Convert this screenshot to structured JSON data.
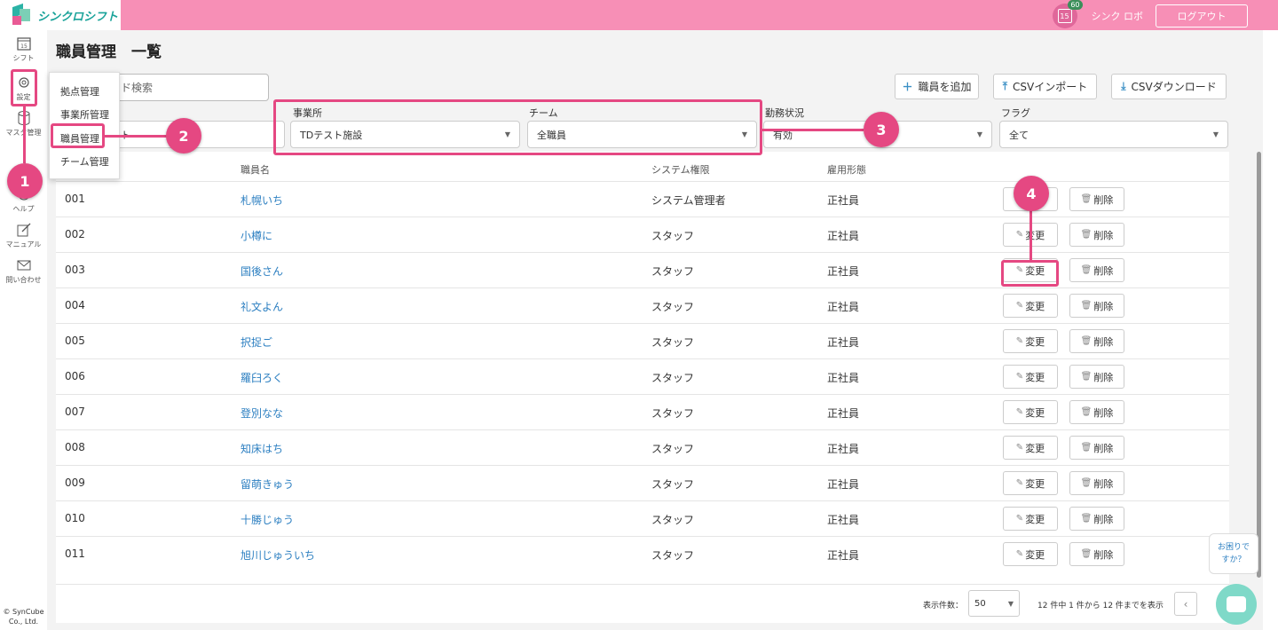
{
  "app": {
    "logo_text": "シンクロシフト",
    "user_name": "シンク ロボ",
    "notification_count": "60",
    "calendar_day": "15",
    "logout_label": "ログアウト"
  },
  "sidebar": {
    "items": [
      {
        "label": "シフト",
        "icon": "calendar-icon"
      },
      {
        "label": "設定",
        "icon": "gear-icon"
      },
      {
        "label": "マスタ管理",
        "icon": "database-icon"
      },
      {
        "label": "ヘルプ",
        "icon": "help-icon"
      },
      {
        "label": "マニュアル",
        "icon": "edit-icon"
      },
      {
        "label": "問い合わせ",
        "icon": "mail-icon"
      }
    ],
    "copyright_line1": "© SynCube",
    "copyright_line2": "Co., Ltd."
  },
  "settings_menu": {
    "items": [
      "拠点管理",
      "事業所管理",
      "職員管理",
      "チーム管理"
    ]
  },
  "page": {
    "title": "職員管理　一覧",
    "search_text": "ド検索",
    "buttons": {
      "add": "職員を追加",
      "csv_import": "CSVインポート",
      "csv_download": "CSVダウンロード"
    }
  },
  "filters": {
    "office": {
      "label": "事業所",
      "value": "TDテスト施設"
    },
    "team": {
      "label": "チーム",
      "value": "全職員"
    },
    "status": {
      "label": "勤務状況",
      "value": "有効"
    },
    "flag": {
      "label": "フラグ",
      "value": "全て"
    },
    "left_partial_value": "ト"
  },
  "table": {
    "headers": [
      "職員名",
      "システム権限",
      "雇用形態"
    ],
    "edit_label": "変更",
    "delete_label": "削除",
    "rows": [
      {
        "id": "001",
        "name": "札幌いち",
        "role": "システム管理者",
        "type": "正社員"
      },
      {
        "id": "002",
        "name": "小樽に",
        "role": "スタッフ",
        "type": "正社員"
      },
      {
        "id": "003",
        "name": "国後さん",
        "role": "スタッフ",
        "type": "正社員"
      },
      {
        "id": "004",
        "name": "礼文よん",
        "role": "スタッフ",
        "type": "正社員"
      },
      {
        "id": "005",
        "name": "択捉ご",
        "role": "スタッフ",
        "type": "正社員"
      },
      {
        "id": "006",
        "name": "羅臼ろく",
        "role": "スタッフ",
        "type": "正社員"
      },
      {
        "id": "007",
        "name": "登別なな",
        "role": "スタッフ",
        "type": "正社員"
      },
      {
        "id": "008",
        "name": "知床はち",
        "role": "スタッフ",
        "type": "正社員"
      },
      {
        "id": "009",
        "name": "留萌きゅう",
        "role": "スタッフ",
        "type": "正社員"
      },
      {
        "id": "010",
        "name": "十勝じゅう",
        "role": "スタッフ",
        "type": "正社員"
      },
      {
        "id": "011",
        "name": "旭川じゅういち",
        "role": "スタッフ",
        "type": "正社員"
      }
    ]
  },
  "pagination": {
    "per_page_label": "表示件数：",
    "per_page_value": "50",
    "info": "12 件中 1 件から 12 件までを表示"
  },
  "help": {
    "line1": "お困りで",
    "line2": "すか？"
  },
  "annotations": [
    "1",
    "2",
    "3",
    "4"
  ],
  "colors": {
    "header": "#f78fb6",
    "accent": "#e54882",
    "link": "#2c7fc1",
    "brand": "#1aa39a"
  }
}
